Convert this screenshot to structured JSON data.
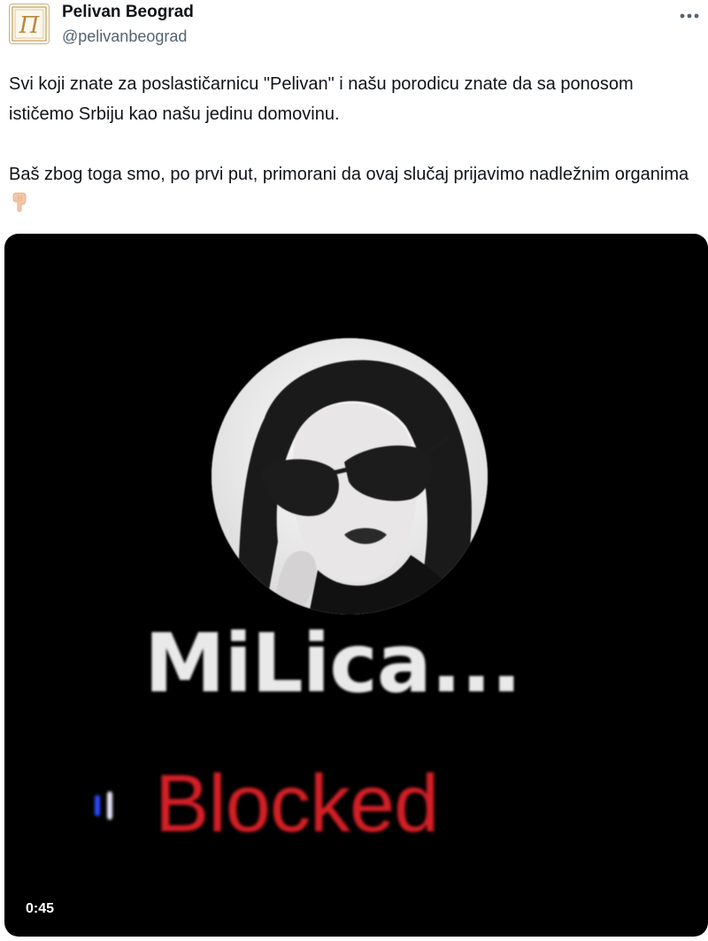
{
  "author": {
    "display_name": "Pelivan Beograd",
    "handle": "@pelivanbeograd",
    "avatar_icon": "pelivan-logo-icon",
    "logo_letters": "П"
  },
  "more_icon": "more-horizontal-icon",
  "tweet": {
    "paragraph_1": "Svi koji znate za poslastičarnicu \"Pelivan\" i našu porodicu znate da sa ponosom ističemo Srbiju kao našu jedinu domovinu.",
    "paragraph_2": "Baš zbog toga smo, po prvi put, primorani da ovaj slučaj prijavimo nadležnim organima",
    "emoji_icon": "pointing-down-hand-icon"
  },
  "video": {
    "caller_name": "MiLica...",
    "status_text": "Blocked",
    "duration": "0:45",
    "colors": {
      "status": "#d31f26",
      "caller_text": "#e9e9e9",
      "background": "#000000",
      "indicator": "#2a4bff"
    }
  }
}
